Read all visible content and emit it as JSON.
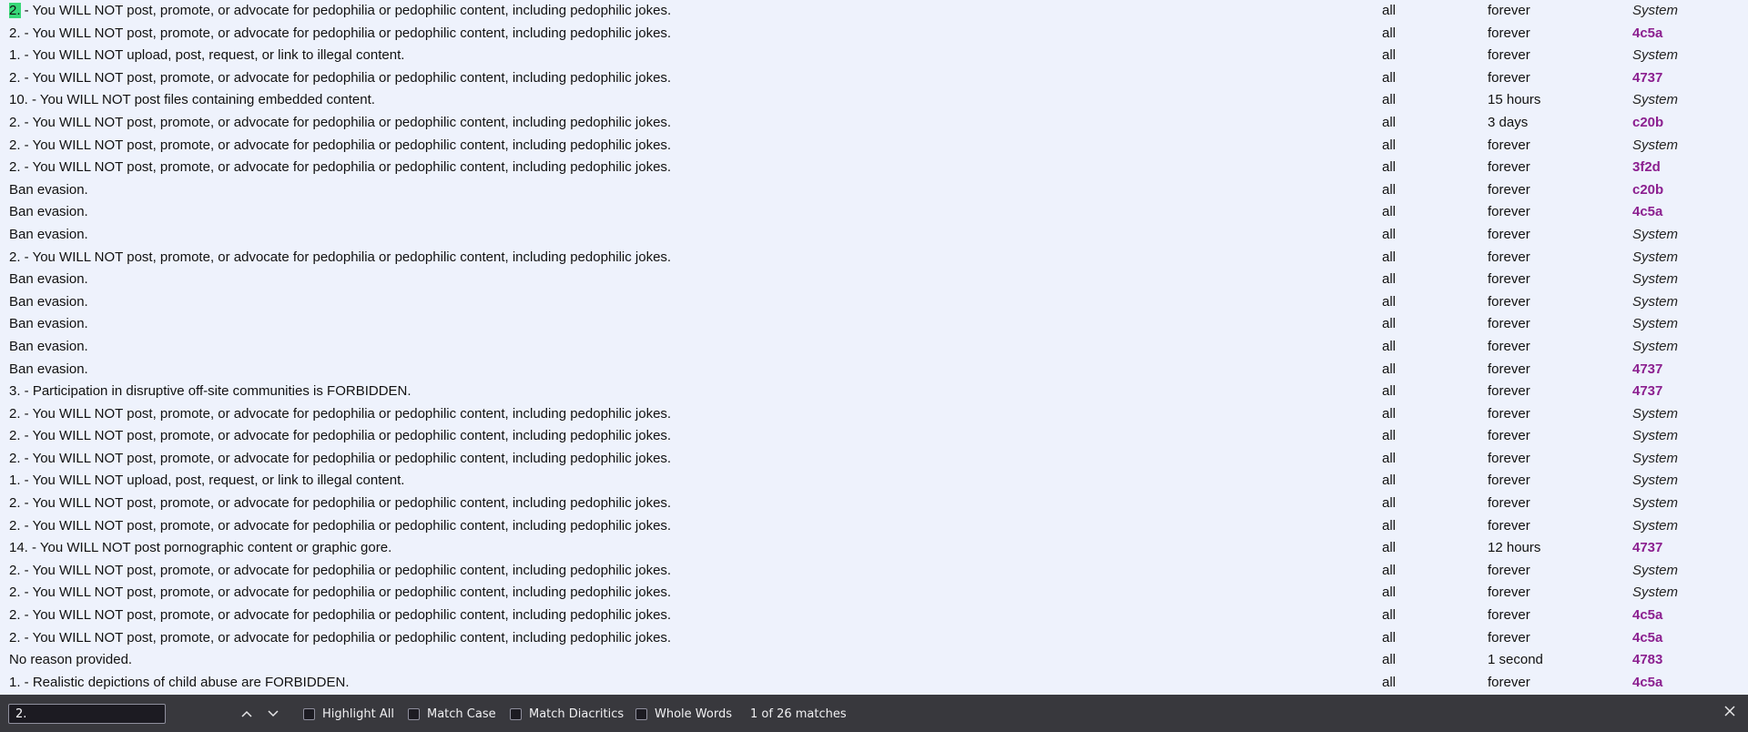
{
  "rows": [
    {
      "pre": "",
      "hit": "2.",
      "post": " - You WILL NOT post, promote, or advocate for pedophilia or pedophilic content, including pedophilic jokes.",
      "board": "all",
      "duration": "forever",
      "staff": "System"
    },
    {
      "reason": "2. - You WILL NOT post, promote, or advocate for pedophilia or pedophilic content, including pedophilic jokes.",
      "board": "all",
      "duration": "forever",
      "staff": "4c5a"
    },
    {
      "reason": "1. - You WILL NOT upload, post, request, or link to illegal content.",
      "board": "all",
      "duration": "forever",
      "staff": "System"
    },
    {
      "reason": "2. - You WILL NOT post, promote, or advocate for pedophilia or pedophilic content, including pedophilic jokes.",
      "board": "all",
      "duration": "forever",
      "staff": "4737"
    },
    {
      "reason": "10. - You WILL NOT post files containing embedded content.",
      "board": "all",
      "duration": "15 hours",
      "staff": "System"
    },
    {
      "reason": "2. - You WILL NOT post, promote, or advocate for pedophilia or pedophilic content, including pedophilic jokes.",
      "board": "all",
      "duration": "3 days",
      "staff": "c20b"
    },
    {
      "reason": "2. - You WILL NOT post, promote, or advocate for pedophilia or pedophilic content, including pedophilic jokes.",
      "board": "all",
      "duration": "forever",
      "staff": "System"
    },
    {
      "reason": "2. - You WILL NOT post, promote, or advocate for pedophilia or pedophilic content, including pedophilic jokes.",
      "board": "all",
      "duration": "forever",
      "staff": "3f2d"
    },
    {
      "reason": "Ban evasion.",
      "board": "all",
      "duration": "forever",
      "staff": "c20b"
    },
    {
      "reason": "Ban evasion.",
      "board": "all",
      "duration": "forever",
      "staff": "4c5a"
    },
    {
      "reason": "Ban evasion.",
      "board": "all",
      "duration": "forever",
      "staff": "System"
    },
    {
      "reason": "2. - You WILL NOT post, promote, or advocate for pedophilia or pedophilic content, including pedophilic jokes.",
      "board": "all",
      "duration": "forever",
      "staff": "System"
    },
    {
      "reason": "Ban evasion.",
      "board": "all",
      "duration": "forever",
      "staff": "System"
    },
    {
      "reason": "Ban evasion.",
      "board": "all",
      "duration": "forever",
      "staff": "System"
    },
    {
      "reason": "Ban evasion.",
      "board": "all",
      "duration": "forever",
      "staff": "System"
    },
    {
      "reason": "Ban evasion.",
      "board": "all",
      "duration": "forever",
      "staff": "System"
    },
    {
      "reason": "Ban evasion.",
      "board": "all",
      "duration": "forever",
      "staff": "4737"
    },
    {
      "reason": "3. - Participation in disruptive off-site communities is FORBIDDEN.",
      "board": "all",
      "duration": "forever",
      "staff": "4737"
    },
    {
      "reason": "2. - You WILL NOT post, promote, or advocate for pedophilia or pedophilic content, including pedophilic jokes.",
      "board": "all",
      "duration": "forever",
      "staff": "System"
    },
    {
      "reason": "2. - You WILL NOT post, promote, or advocate for pedophilia or pedophilic content, including pedophilic jokes.",
      "board": "all",
      "duration": "forever",
      "staff": "System"
    },
    {
      "reason": "2. - You WILL NOT post, promote, or advocate for pedophilia or pedophilic content, including pedophilic jokes.",
      "board": "all",
      "duration": "forever",
      "staff": "System"
    },
    {
      "reason": "1. - You WILL NOT upload, post, request, or link to illegal content.",
      "board": "all",
      "duration": "forever",
      "staff": "System"
    },
    {
      "reason": "2. - You WILL NOT post, promote, or advocate for pedophilia or pedophilic content, including pedophilic jokes.",
      "board": "all",
      "duration": "forever",
      "staff": "System"
    },
    {
      "reason": "2. - You WILL NOT post, promote, or advocate for pedophilia or pedophilic content, including pedophilic jokes.",
      "board": "all",
      "duration": "forever",
      "staff": "System"
    },
    {
      "reason": "14. - You WILL NOT post pornographic content or graphic gore.",
      "board": "all",
      "duration": "12 hours",
      "staff": "4737"
    },
    {
      "reason": "2. - You WILL NOT post, promote, or advocate for pedophilia or pedophilic content, including pedophilic jokes.",
      "board": "all",
      "duration": "forever",
      "staff": "System"
    },
    {
      "reason": "2. - You WILL NOT post, promote, or advocate for pedophilia or pedophilic content, including pedophilic jokes.",
      "board": "all",
      "duration": "forever",
      "staff": "System"
    },
    {
      "reason": "2. - You WILL NOT post, promote, or advocate for pedophilia or pedophilic content, including pedophilic jokes.",
      "board": "all",
      "duration": "forever",
      "staff": "4c5a"
    },
    {
      "reason": "2. - You WILL NOT post, promote, or advocate for pedophilia or pedophilic content, including pedophilic jokes.",
      "board": "all",
      "duration": "forever",
      "staff": "4c5a"
    },
    {
      "reason": "No reason provided.",
      "board": "all",
      "duration": "1 second",
      "staff": "4783"
    },
    {
      "reason": "1. - Realistic depictions of child abuse are FORBIDDEN.",
      "board": "all",
      "duration": "forever",
      "staff": "4c5a"
    }
  ],
  "findbar": {
    "query": "2.",
    "highlight_all": "Highlight All",
    "match_case": "Match Case",
    "match_diacritics": "Match Diacritics",
    "whole_words": "Whole Words",
    "status": "1 of 26 matches",
    "prev_icon": "chevron-up-icon",
    "next_icon": "chevron-down-icon",
    "close_icon": "close-icon"
  },
  "colors": {
    "page_bg": "#eef2fc",
    "staff_hash": "#8b1f8f",
    "match_highlight": "#38d878",
    "findbar_bg": "#38383d"
  }
}
